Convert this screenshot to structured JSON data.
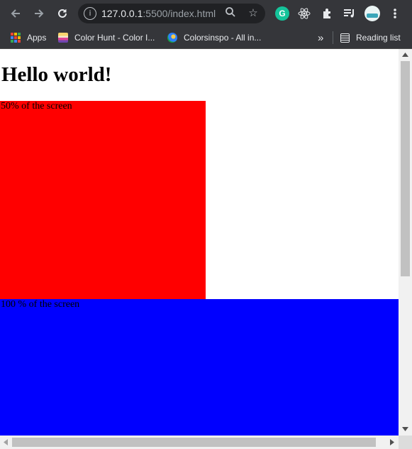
{
  "browser": {
    "url_host": "127.0.0.1",
    "url_rest": ":5500/index.html",
    "bookmarks": [
      {
        "label": "Apps"
      },
      {
        "label": "Color Hunt - Color I..."
      },
      {
        "label": "Colorsinspo - All in..."
      }
    ],
    "overflow_label": "»",
    "reading_list_label": "Reading list"
  },
  "page": {
    "heading": "Hello world!",
    "red_box_label": "50% of the screen",
    "blue_box_label": "100 % of the screen",
    "colors": {
      "red_box": "#ff0000",
      "blue_box": "#0000ff"
    }
  }
}
